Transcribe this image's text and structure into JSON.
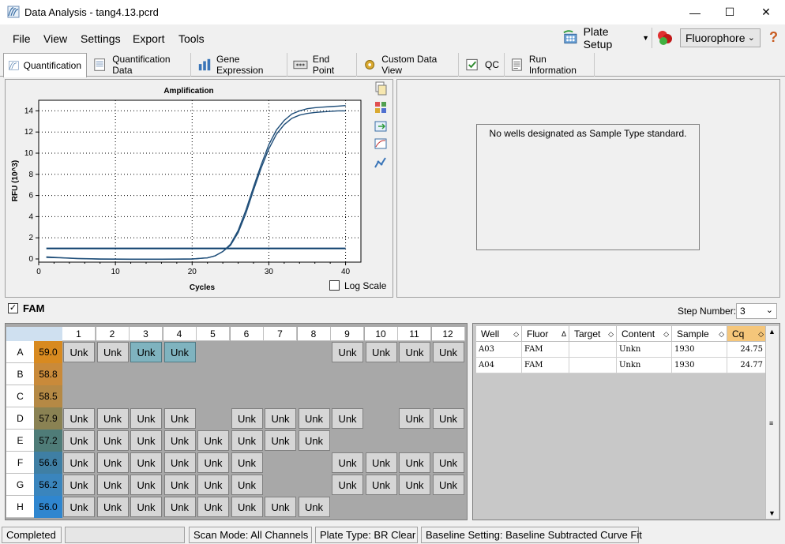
{
  "window": {
    "title": "Data Analysis - tang4.13.pcrd"
  },
  "menu": {
    "file": "File",
    "view": "View",
    "settings": "Settings",
    "export": "Export",
    "tools": "Tools",
    "plate_setup": "Plate Setup",
    "fluorophore": "Fluorophore",
    "help": "?"
  },
  "tabs": [
    "Quantification",
    "Quantification Data",
    "Gene Expression",
    "End Point",
    "Custom Data View",
    "QC",
    "Run Information"
  ],
  "standard_panel": {
    "message": "No wells designated as Sample Type standard."
  },
  "filter": {
    "fluor": "FAM",
    "step_label": "Step Number:",
    "step_value": "3"
  },
  "log_scale_label": "Log Scale",
  "chart_data": {
    "type": "line",
    "title": "Amplification",
    "xlabel": "Cycles",
    "ylabel": "RFU (10^3)",
    "xlim": [
      0,
      42
    ],
    "ylim": [
      -0.3,
      15
    ],
    "xticks": [
      0,
      10,
      20,
      30,
      40
    ],
    "yticks": [
      0,
      2,
      4,
      6,
      8,
      10,
      12,
      14
    ],
    "threshold": 1.0,
    "series": [
      {
        "x": [
          1,
          3,
          5,
          8,
          12,
          16,
          20,
          22,
          23,
          24,
          25,
          26,
          27,
          28,
          29,
          30,
          31,
          32,
          33,
          34,
          35,
          36,
          37,
          38,
          39,
          40
        ],
        "y": [
          0.2,
          0.12,
          0.05,
          0.0,
          -0.02,
          -0.02,
          0.0,
          0.1,
          0.3,
          0.7,
          1.4,
          2.7,
          4.6,
          6.8,
          8.9,
          10.8,
          12.2,
          13.1,
          13.7,
          14.0,
          14.2,
          14.3,
          14.35,
          14.4,
          14.45,
          14.5
        ]
      },
      {
        "x": [
          1,
          3,
          5,
          8,
          12,
          16,
          20,
          22,
          23,
          24,
          25,
          26,
          27,
          28,
          29,
          30,
          31,
          32,
          33,
          34,
          35,
          36,
          37,
          38,
          39,
          40
        ],
        "y": [
          0.15,
          0.1,
          0.03,
          -0.02,
          -0.03,
          -0.03,
          0.0,
          0.1,
          0.3,
          0.7,
          1.3,
          2.5,
          4.3,
          6.5,
          8.6,
          10.4,
          11.8,
          12.7,
          13.3,
          13.6,
          13.75,
          13.85,
          13.9,
          13.95,
          14.0,
          14.0
        ]
      }
    ]
  },
  "plate": {
    "columns": [
      "1",
      "2",
      "3",
      "4",
      "5",
      "6",
      "7",
      "8",
      "9",
      "10",
      "11",
      "12"
    ],
    "rows": [
      {
        "label": "A",
        "temp": "59.0",
        "color": "#d88a20",
        "wells": [
          "Unk",
          "Unk",
          "Unk*",
          "Unk*",
          "",
          "",
          "",
          "",
          "Unk",
          "Unk",
          "Unk",
          "Unk"
        ]
      },
      {
        "label": "B",
        "temp": "58.8",
        "color": "#c98a3a",
        "wells": [
          "",
          "",
          "",
          "",
          "",
          "",
          "",
          "",
          "",
          "",
          "",
          ""
        ]
      },
      {
        "label": "C",
        "temp": "58.5",
        "color": "#b58945",
        "wells": [
          "",
          "",
          "",
          "",
          "",
          "",
          "",
          "",
          "",
          "",
          "",
          ""
        ]
      },
      {
        "label": "D",
        "temp": "57.9",
        "color": "#8a8253",
        "wells": [
          "Unk",
          "Unk",
          "Unk",
          "Unk",
          "",
          "Unk",
          "Unk",
          "Unk",
          "Unk",
          "",
          "Unk",
          "Unk"
        ]
      },
      {
        "label": "E",
        "temp": "57.2",
        "color": "#4f7c78",
        "wells": [
          "Unk",
          "Unk",
          "Unk",
          "Unk",
          "Unk",
          "Unk",
          "Unk",
          "Unk",
          "",
          "",
          "",
          ""
        ]
      },
      {
        "label": "F",
        "temp": "56.6",
        "color": "#3f7fa4",
        "wells": [
          "Unk",
          "Unk",
          "Unk",
          "Unk",
          "Unk",
          "Unk",
          "",
          "",
          "Unk",
          "Unk",
          "Unk",
          "Unk"
        ]
      },
      {
        "label": "G",
        "temp": "56.2",
        "color": "#3a85bd",
        "wells": [
          "Unk",
          "Unk",
          "Unk",
          "Unk",
          "Unk",
          "Unk",
          "",
          "",
          "Unk",
          "Unk",
          "Unk",
          "Unk"
        ]
      },
      {
        "label": "H",
        "temp": "56.0",
        "color": "#2f86cf",
        "wells": [
          "Unk",
          "Unk",
          "Unk",
          "Unk",
          "Unk",
          "Unk",
          "Unk",
          "Unk",
          "",
          "",
          "",
          ""
        ]
      }
    ]
  },
  "results_table": {
    "headers": [
      "Well",
      "Fluor",
      "Target",
      "Content",
      "Sample",
      "Cq"
    ],
    "rows": [
      [
        "A03",
        "FAM",
        "",
        "Unkn",
        "1930",
        "24.75"
      ],
      [
        "A04",
        "FAM",
        "",
        "Unkn",
        "1930",
        "24.77"
      ]
    ]
  },
  "status": {
    "state": "Completed",
    "scan_mode": "Scan Mode: All Channels",
    "plate_type": "Plate Type: BR Clear",
    "baseline": "Baseline Setting: Baseline Subtracted Curve Fit"
  },
  "colors": {
    "curve": "#1f4e79",
    "threshold": "#0b3d6b",
    "selected_well": "#7fb3bf",
    "cq_header": "#f5c67a"
  }
}
